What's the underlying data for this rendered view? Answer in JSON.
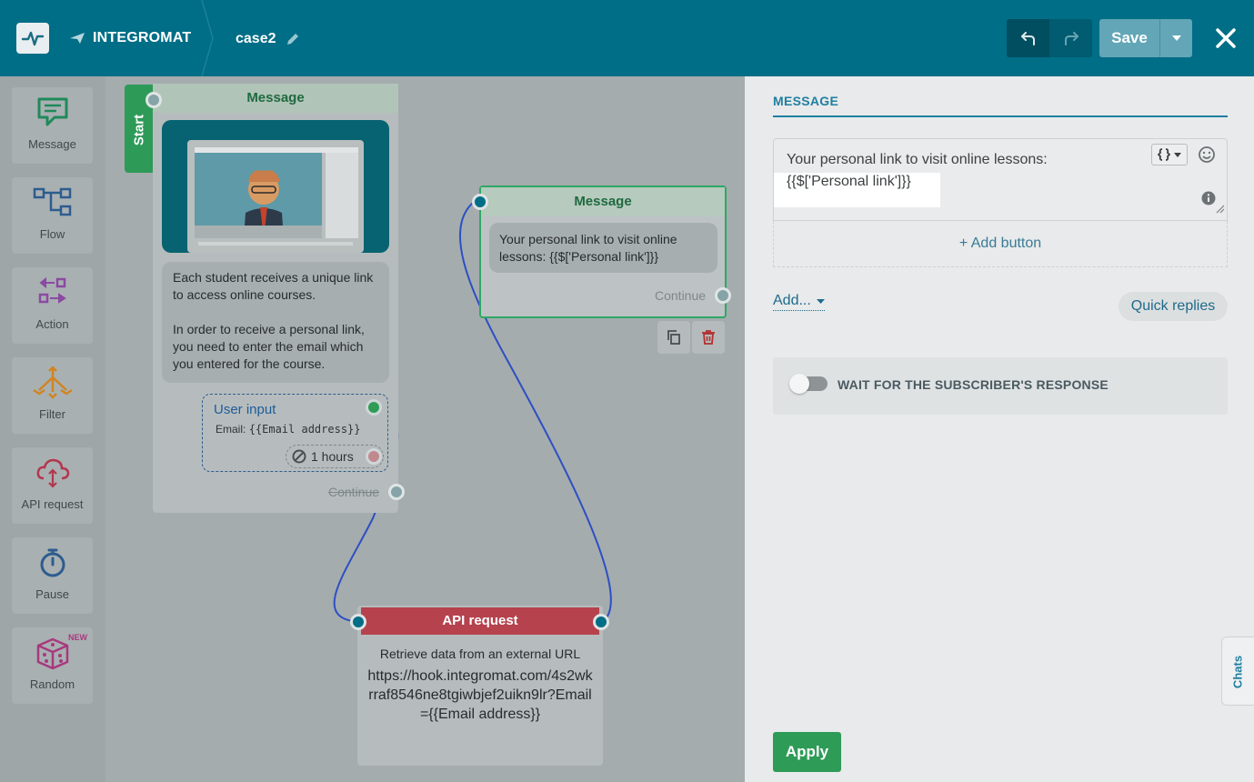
{
  "header": {
    "brand": "INTEGROMAT",
    "project_name": "case2",
    "save_label": "Save"
  },
  "tools": [
    {
      "label": "Message",
      "icon": "message-icon"
    },
    {
      "label": "Flow",
      "icon": "flow-icon"
    },
    {
      "label": "Action",
      "icon": "action-icon"
    },
    {
      "label": "Filter",
      "icon": "filter-icon"
    },
    {
      "label": "API request",
      "icon": "cloud-icon"
    },
    {
      "label": "Pause",
      "icon": "stopwatch-icon"
    },
    {
      "label": "Random",
      "icon": "dice-icon",
      "badge": "NEW"
    }
  ],
  "canvas": {
    "start_label": "Start",
    "node1": {
      "title": "Message",
      "bubble_line1": "Each student receives a unique link to access online courses.",
      "bubble_line2": "In order to receive a personal link, you need to enter the email which you entered for the course.",
      "user_input": {
        "title": "User input",
        "email_label": "Email:",
        "email_var": "{{Email address}}",
        "timeout": "1 hours"
      },
      "continue": "Continue"
    },
    "node2": {
      "title": "Message",
      "bubble": "Your personal link to visit online lessons: {{$['Personal link']}}",
      "continue": "Continue"
    },
    "node3": {
      "title": "API request",
      "description": "Retrieve data from an external URL",
      "url": "https://hook.integromat.com/4s2wkrraf8546ne8tgiwbjef2uikn9lr?Email={{Email address}}"
    }
  },
  "panel": {
    "title": "MESSAGE",
    "editor_line1": "Your personal link to visit online lessons:",
    "editor_line2": "{{$['Personal link']}}",
    "add_button": "+ Add button",
    "add_link": "Add...",
    "quick_replies": "Quick replies",
    "wait_label": "WAIT FOR THE SUBSCRIBER'S RESPONSE",
    "wait_enabled": false,
    "apply": "Apply",
    "chats_tab": "Chats"
  },
  "colors": {
    "header": "#006e86",
    "accent_green": "#2e9b57",
    "api_red": "#b5424d",
    "link_blue": "#1f7fa0"
  }
}
